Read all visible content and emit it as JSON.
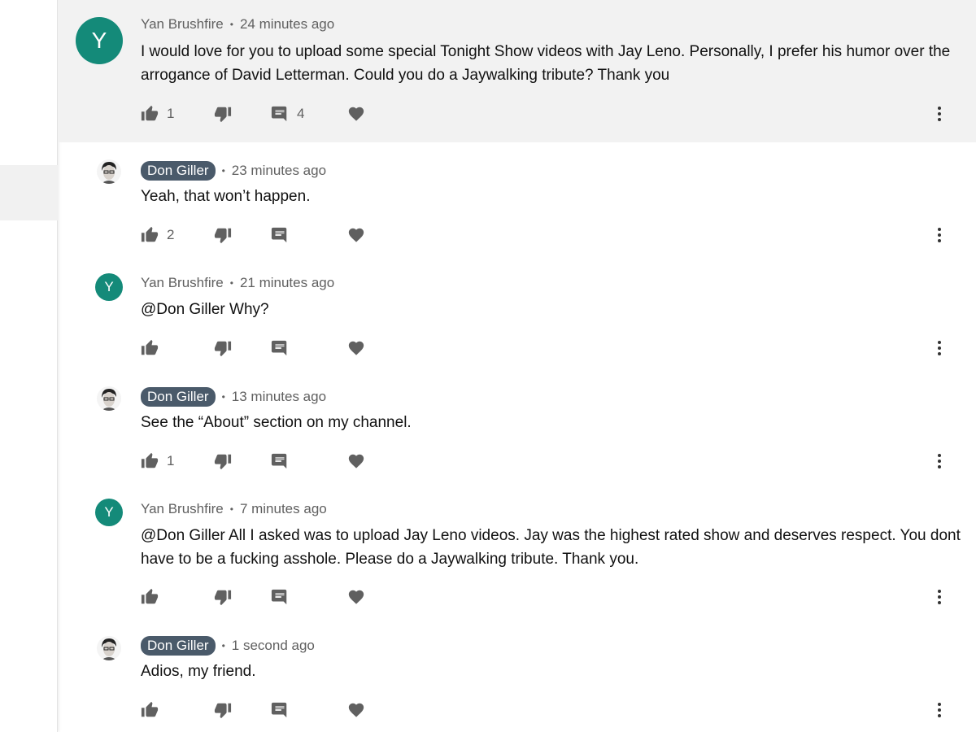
{
  "colors": {
    "avatar_green": "#148a79",
    "author_chip": "#4a5a6a",
    "highlight_bg": "#f2f2f2"
  },
  "comments": [
    {
      "author": "Yan Brushfire",
      "author_is_channel_owner": false,
      "avatar_letter": "Y",
      "time": "24 minutes ago",
      "text": "I would love for you to upload some special Tonight Show videos with Jay Leno. Personally,  I prefer his humor over the arrogance of David Letterman. Could you do a Jaywalking tribute? Thank you",
      "likes": "1",
      "replies": "4",
      "highlighted": true
    },
    {
      "author": "Don Giller",
      "author_is_channel_owner": true,
      "avatar_letter": "",
      "time": "23 minutes ago",
      "text": "Yeah, that won’t happen.",
      "likes": "2",
      "replies": ""
    },
    {
      "author": "Yan Brushfire",
      "author_is_channel_owner": false,
      "avatar_letter": "Y",
      "time": "21 minutes ago",
      "text": "@Don Giller Why?",
      "likes": "",
      "replies": ""
    },
    {
      "author": "Don Giller",
      "author_is_channel_owner": true,
      "avatar_letter": "",
      "time": "13 minutes ago",
      "text": "See the “About” section on my channel.",
      "likes": "1",
      "replies": ""
    },
    {
      "author": "Yan Brushfire",
      "author_is_channel_owner": false,
      "avatar_letter": "Y",
      "time": "7 minutes ago",
      "text": "@Don Giller All I asked was to upload Jay Leno videos. Jay was the highest rated show and deserves respect. You dont have to be a fucking asshole. Please do a Jaywalking tribute.  Thank you.",
      "likes": "",
      "replies": ""
    },
    {
      "author": "Don Giller",
      "author_is_channel_owner": true,
      "avatar_letter": "",
      "time": "1 second ago",
      "text": "Adios, my friend.",
      "likes": "",
      "replies": ""
    }
  ],
  "separator": "•"
}
